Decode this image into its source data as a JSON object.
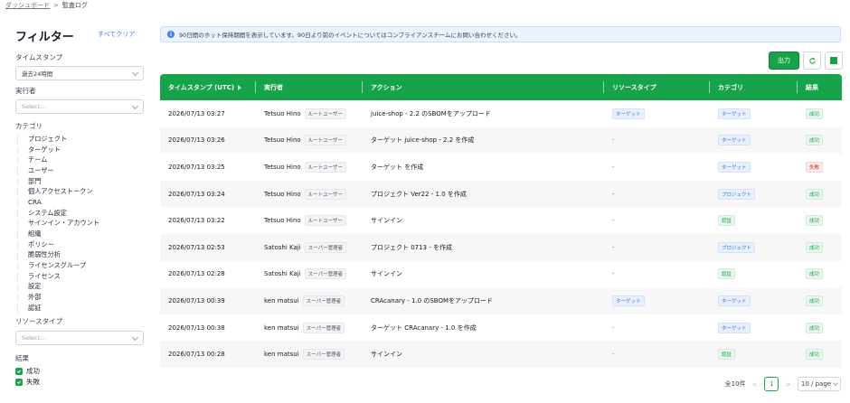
{
  "breadcrumb": {
    "parent": "ダッシュボード",
    "separator": ">",
    "current": "監査ログ"
  },
  "sidebar": {
    "title": "フィルター",
    "clear_all": "すべてクリア",
    "time_stamp": {
      "label": "タイムスタンプ",
      "value": "過去24時間"
    },
    "actor": {
      "label": "実行者",
      "placeholder": "Select..."
    },
    "category": {
      "label": "カテゴリ",
      "items": [
        "プロジェクト",
        "ターゲット",
        "チーム",
        "ユーザー",
        "部門",
        "個人アクセストークン",
        "CRA",
        "システム設定",
        "サインイン・アカウント",
        "組織",
        "ポリシー",
        "脆弱性分析",
        "ライセンスグループ",
        "ライセンス",
        "設定",
        "外部",
        "認証"
      ]
    },
    "resource_type": {
      "label": "リソースタイプ",
      "placeholder": "Select..."
    },
    "result": {
      "label": "結果",
      "options": [
        "成功",
        "失敗"
      ]
    }
  },
  "banner": {
    "icon": "info-icon",
    "text": "90日間のホット保持期間を表示しています。90日より前のイベントについてはコンプライアンスチームにお問い合わせください。"
  },
  "toolbar": {
    "export_label": "出力",
    "refresh_icon": "refresh-icon",
    "columns_icon": "column-settings-icon"
  },
  "table": {
    "headers": [
      "タイムスタンプ (UTC)",
      "実行者",
      "アクション",
      "リソースタイプ",
      "カテゴリ",
      "結果"
    ],
    "rows": [
      {
        "timestamp": "2026/07/13 03:27",
        "actor": "Tetsuo Hino",
        "role": "ルートユーザー",
        "action": "juice-shop - 2.2 のSBOMをアップロード",
        "resource": "ターゲット",
        "category": "ターゲット",
        "result": "成功",
        "result_type": "green",
        "category_type": "blue"
      },
      {
        "timestamp": "2026/07/13 03:26",
        "actor": "Tetsuo Hino",
        "role": "ルートユーザー",
        "action": "ターゲット juice-shop - 2.2 を作成",
        "resource": "-",
        "category": "ターゲット",
        "result": "成功",
        "result_type": "green",
        "category_type": "blue"
      },
      {
        "timestamp": "2026/07/13 03:25",
        "actor": "Tetsuo Hino",
        "role": "ルートユーザー",
        "action": "ターゲット を作成",
        "resource": "-",
        "category": "ターゲット",
        "result": "失敗",
        "result_type": "red",
        "category_type": "blue"
      },
      {
        "timestamp": "2026/07/13 03:24",
        "actor": "Tetsuo Hino",
        "role": "ルートユーザー",
        "action": "プロジェクト Ver22 - 1.0 を作成",
        "resource": "-",
        "category": "プロジェクト",
        "result": "成功",
        "result_type": "green",
        "category_type": "blue"
      },
      {
        "timestamp": "2026/07/13 03:22",
        "actor": "Tetsuo Hino",
        "role": "ルートユーザー",
        "action": "サインイン",
        "resource": "-",
        "category": "認証",
        "result": "成功",
        "result_type": "green",
        "category_type": "green"
      },
      {
        "timestamp": "2026/07/13 02:53",
        "actor": "Satoshi Kaji",
        "role": "スーパー管理者",
        "action": "プロジェクト 0713 - を作成",
        "resource": "-",
        "category": "プロジェクト",
        "result": "成功",
        "result_type": "green",
        "category_type": "blue"
      },
      {
        "timestamp": "2026/07/13 02:28",
        "actor": "Satoshi Kaji",
        "role": "スーパー管理者",
        "action": "サインイン",
        "resource": "-",
        "category": "認証",
        "result": "成功",
        "result_type": "green",
        "category_type": "green"
      },
      {
        "timestamp": "2026/07/13 00:39",
        "actor": "ken matsui",
        "role": "スーパー管理者",
        "action": "CRAcanary - 1.0 のSBOMをアップロード",
        "resource": "ターゲット",
        "category": "ターゲット",
        "result": "成功",
        "result_type": "green",
        "category_type": "blue"
      },
      {
        "timestamp": "2026/07/13 00:38",
        "actor": "ken matsui",
        "role": "スーパー管理者",
        "action": "ターゲット CRAcanary - 1.0 を作成",
        "resource": "-",
        "category": "ターゲット",
        "result": "成功",
        "result_type": "green",
        "category_type": "blue"
      },
      {
        "timestamp": "2026/07/13 00:28",
        "actor": "ken matsui",
        "role": "スーパー管理者",
        "action": "サインイン",
        "resource": "-",
        "category": "認証",
        "result": "成功",
        "result_type": "green",
        "category_type": "green"
      }
    ]
  },
  "pagination": {
    "total": "全10件",
    "prev": "<",
    "page": "1",
    "next": ">",
    "page_size": "10 / page"
  },
  "colors": {
    "accent": "#16a34a",
    "info_bg": "#eaf2fd",
    "tag_blue": "#3b6fd8",
    "tag_red": "#dc2626"
  }
}
